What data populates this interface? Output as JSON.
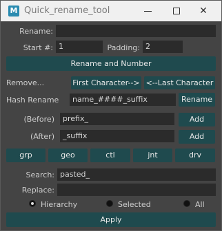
{
  "window": {
    "title": "Quick_rename_tool",
    "app_icon_letter": "M"
  },
  "rename_section": {
    "rename_label": "Rename:",
    "rename_value": "",
    "start_label": "Start #:",
    "start_value": "1",
    "padding_label": "Padding:",
    "padding_value": "2",
    "rename_number_button": "Rename and Number"
  },
  "remove_section": {
    "remove_label": "Remove...",
    "first_char_button": "First Character-->",
    "last_char_button": "<--Last Character",
    "hash_label": "Hash Rename",
    "hash_value": "name_####_suffix",
    "hash_button": "Rename"
  },
  "prefix_suffix": {
    "before_label": "(Before)",
    "before_value": "prefix_",
    "before_add": "Add",
    "after_label": "(After)",
    "after_value": "_suffix",
    "after_add": "Add"
  },
  "quick_suffix_buttons": [
    "grp",
    "geo",
    "ctl",
    "jnt",
    "drv"
  ],
  "search_replace": {
    "search_label": "Search:",
    "search_value": "pasted_",
    "replace_label": "Replace:",
    "replace_value": "",
    "scope_options": [
      "Hierarchy",
      "Selected",
      "All"
    ],
    "scope_selected": "Hierarchy",
    "apply_button": "Apply"
  }
}
